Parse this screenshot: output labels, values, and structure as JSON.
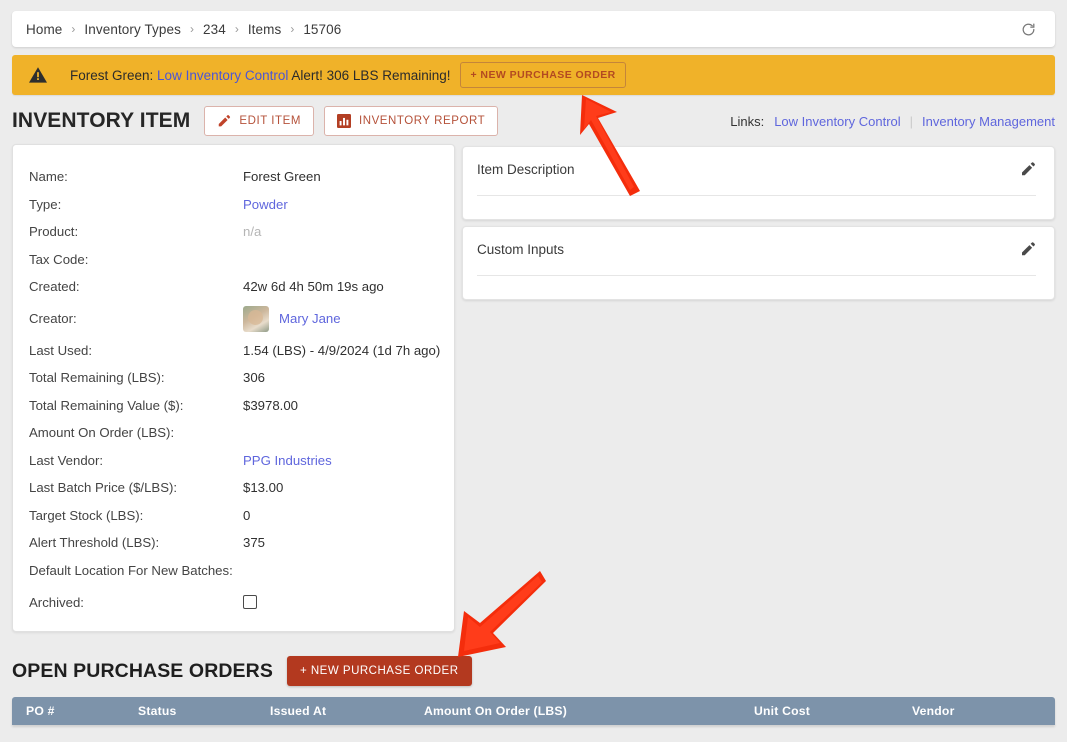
{
  "breadcrumb": {
    "items": [
      "Home",
      "Inventory Types",
      "234",
      "Items",
      "15706"
    ],
    "separator": "›",
    "refresh_icon": "refresh-icon"
  },
  "alert": {
    "icon": "warning-triangle-icon",
    "prefix": "Forest Green:",
    "link_text": "Low Inventory Control",
    "suffix": "Alert! 306 LBS Remaining!",
    "button_label": "+ NEW PURCHASE ORDER",
    "background_color": "#f0b229",
    "link_color": "#4b55d6"
  },
  "header": {
    "title": "INVENTORY ITEM",
    "edit_button": "EDIT ITEM",
    "edit_icon": "pencil-icon",
    "report_button": "INVENTORY REPORT",
    "report_icon": "bar-chart-icon",
    "links_label": "Links:",
    "link_divider": "|",
    "links": [
      "Low Inventory Control",
      "Inventory Management"
    ],
    "accent_color": "#b5523a"
  },
  "details": {
    "rows": [
      {
        "label": "Name:",
        "value": "Forest Green",
        "style": "plain"
      },
      {
        "label": "Type:",
        "value": "Powder",
        "style": "link"
      },
      {
        "label": "Product:",
        "value": "n/a",
        "style": "muted"
      },
      {
        "label": "Tax Code:",
        "value": "",
        "style": "plain"
      },
      {
        "label": "Created:",
        "value": "42w 6d 4h 50m 19s ago",
        "style": "plain"
      },
      {
        "label": "Creator:",
        "value": "Mary Jane",
        "style": "avatar-link"
      },
      {
        "label": "Last Used:",
        "value": "1.54 (LBS) - 4/9/2024 (1d 7h ago)",
        "style": "plain"
      },
      {
        "label": "Total Remaining (LBS):",
        "value": "306",
        "style": "plain"
      },
      {
        "label": "Total Remaining Value ($):",
        "value": "$3978.00",
        "style": "plain"
      },
      {
        "label": "Amount On Order (LBS):",
        "value": "",
        "style": "plain"
      },
      {
        "label": "Last Vendor:",
        "value": "PPG Industries",
        "style": "link"
      },
      {
        "label": "Last Batch Price ($/LBS):",
        "value": "$13.00",
        "style": "plain"
      },
      {
        "label": "Target Stock (LBS):",
        "value": "0",
        "style": "plain"
      },
      {
        "label": "Alert Threshold (LBS):",
        "value": "375",
        "style": "plain"
      },
      {
        "label": "Default Location For New Batches:",
        "value": "",
        "style": "plain"
      },
      {
        "label": "Archived:",
        "value": "",
        "style": "checkbox"
      }
    ],
    "archived_checked": false,
    "creator_avatar": "user-avatar",
    "link_color": "#5f66dd"
  },
  "panels": [
    {
      "title": "Item Description",
      "edit_icon": "pencil-icon",
      "content": ""
    },
    {
      "title": "Custom Inputs",
      "edit_icon": "pencil-icon",
      "content": ""
    }
  ],
  "purchase_orders": {
    "section_title": "OPEN PURCHASE ORDERS",
    "new_button": "+ NEW PURCHASE ORDER",
    "new_button_color": "#b3391f",
    "table": {
      "header_color": "#7d93aa",
      "columns": [
        "PO #",
        "Status",
        "Issued At",
        "Amount On Order (LBS)",
        "Unit Cost",
        "Vendor"
      ],
      "rows": []
    }
  },
  "annotations": {
    "color": "#f42d0c",
    "arrows": [
      {
        "name": "arrow-pointing-to-new-purchase-order-banner-button",
        "direction": "up-left"
      },
      {
        "name": "arrow-pointing-to-new-purchase-order-button",
        "direction": "down-left"
      }
    ]
  }
}
